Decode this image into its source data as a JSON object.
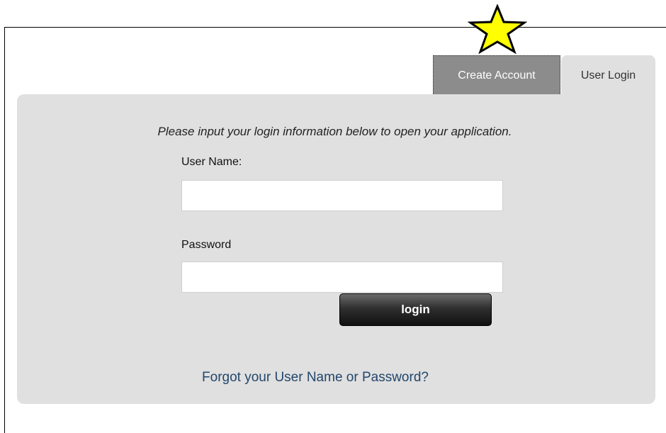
{
  "tabs": {
    "create_account": "Create Account",
    "user_login": "User Login"
  },
  "form": {
    "instructions": "Please input your login information below to open your application.",
    "username_label": "User Name:",
    "username_value": "",
    "password_label": "Password",
    "password_value": "",
    "login_button": "login",
    "forgot_link": "Forgot your User Name or Password?"
  },
  "annotation": {
    "icon": "star-icon",
    "color": "#ffff00"
  },
  "colors": {
    "panel_bg": "#e0e0e0",
    "active_tab_bg": "#8c8c8c",
    "link": "#23466b",
    "button_dark": "#1a1a1a"
  }
}
